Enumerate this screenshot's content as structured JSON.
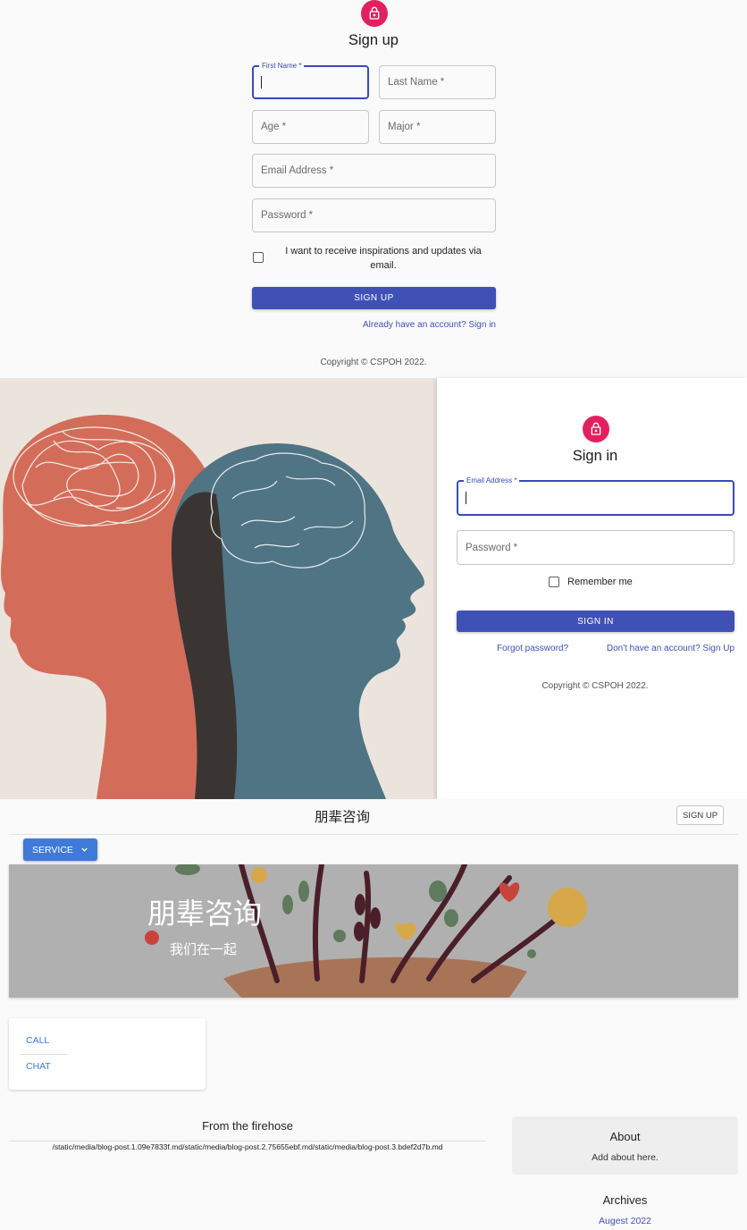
{
  "signup": {
    "title": "Sign up",
    "first_name_label": "First Name *",
    "last_name_placeholder": "Last Name *",
    "age_placeholder": "Age *",
    "major_placeholder": "Major *",
    "email_placeholder": "Email Address *",
    "password_placeholder": "Password *",
    "checkbox_label_line1": "I want to receive inspirations and updates via",
    "checkbox_label_line2": "email.",
    "submit_label": "SIGN UP",
    "signin_link": "Already have an account? Sign in",
    "copyright": "Copyright © CSPOH 2022."
  },
  "signin": {
    "title": "Sign in",
    "email_label": "Email Address *",
    "password_placeholder": "Password *",
    "remember_label": "Remember me",
    "submit_label": "SIGN IN",
    "forgot_link": "Forgot password?",
    "signup_link": "Don't have an account? Sign Up",
    "copyright": "Copyright © CSPOH 2022."
  },
  "home": {
    "brand": "朋辈咨询",
    "signup_button": "SIGN UP",
    "service_button": "SERVICE",
    "hero_title": "朋辈咨询",
    "hero_subtitle": "我们在一起",
    "menu": [
      "CALL",
      "CHAT"
    ],
    "section_title": "From the firehose",
    "posts_text": "/static/media/blog-post.1.09e7833f.md/static/media/blog-post.2.75655ebf.md/static/media/blog-post.3.bdef2d7b.md",
    "about_title": "About",
    "about_text": "Add about here.",
    "archives_title": "Archives",
    "archive_item": "Augest 2022"
  },
  "colors": {
    "accent": "#3f51b5",
    "avatar": "#e3205f",
    "service": "#3f7ad8"
  }
}
